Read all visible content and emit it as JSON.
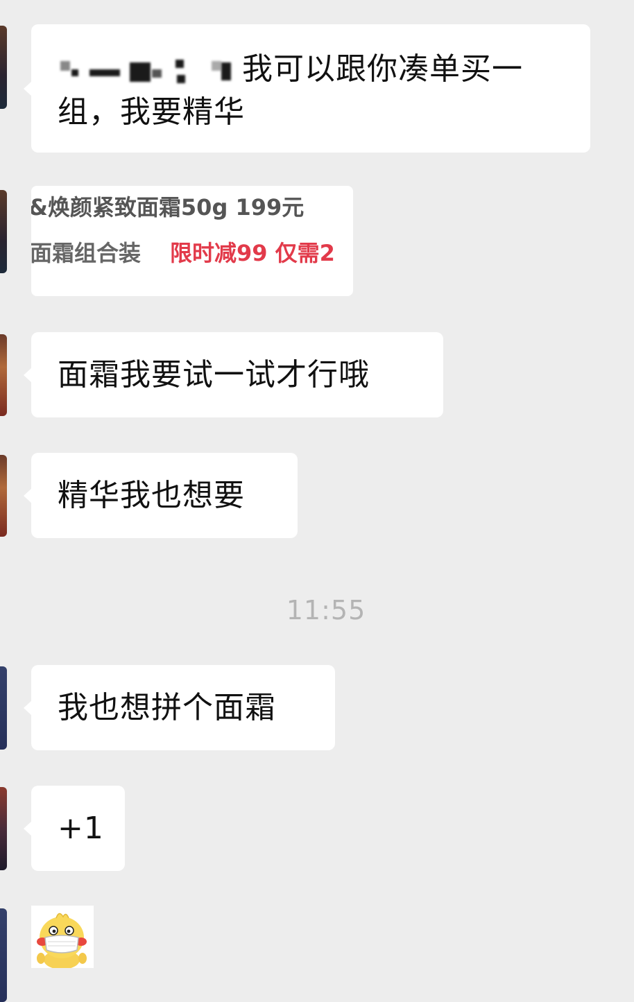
{
  "messages": [
    {
      "text_line1": "我可以跟你凑单买一",
      "text_line2": "组，我要精华"
    },
    {
      "image_text_line1": "&焕颜紧致面霜50g 199元",
      "image_text_line2_gray": "面霜组合装",
      "image_text_line2_red": "限时减99 仅需2"
    },
    {
      "text": "面霜我要试一试才行哦"
    },
    {
      "text": "精华我也想要"
    },
    {
      "text": "我也想拼个面霜"
    },
    {
      "text": "+1"
    }
  ],
  "timestamp": "11:55",
  "sticker": {
    "icon": "duck-mask-sticker-icon"
  },
  "colors": {
    "background": "#ededed",
    "bubble": "#ffffff",
    "promo_red": "#e23a4a",
    "timestamp": "#b4b4b4"
  }
}
